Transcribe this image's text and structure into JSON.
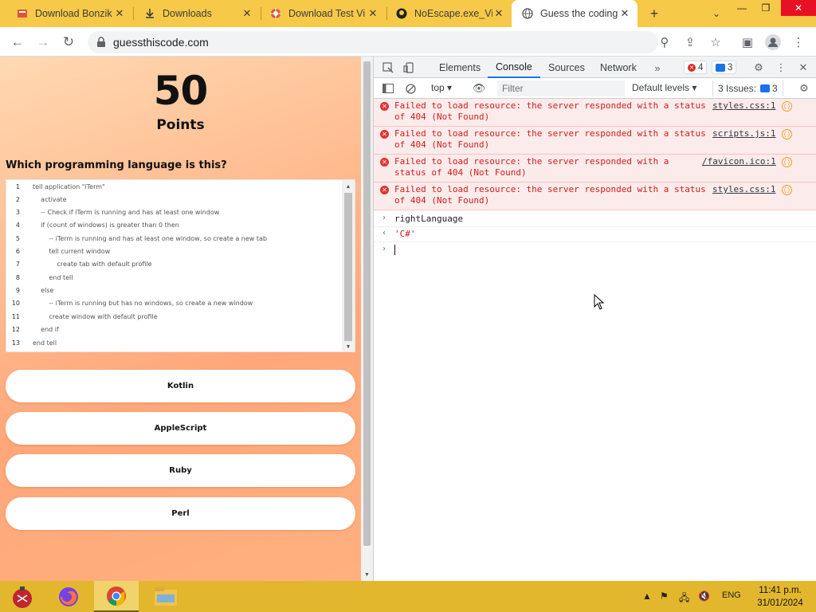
{
  "browser": {
    "tabs": [
      {
        "title": "Download Bonzik",
        "icon": "download-site-icon"
      },
      {
        "title": "Downloads",
        "icon": "download-icon"
      },
      {
        "title": "Download Test Vi",
        "icon": "target-site-icon"
      },
      {
        "title": "NoEscape.exe_Vi",
        "icon": "github-icon"
      },
      {
        "title": "Guess the coding",
        "icon": "globe-icon",
        "active": true
      }
    ],
    "url": "guessthiscode.com"
  },
  "page": {
    "score": "50",
    "score_label": "Points",
    "question": "Which programming language is this?",
    "code_lines": [
      {
        "n": "1",
        "text": "tell application \"iTerm\""
      },
      {
        "n": "2",
        "text": "    activate"
      },
      {
        "n": "3",
        "text": "    -- Check if iTerm is running and has at least one window"
      },
      {
        "n": "4",
        "text": "    if (count of windows) is greater than 0 then"
      },
      {
        "n": "5",
        "text": "        -- iTerm is running and has at least one window, so create a new tab"
      },
      {
        "n": "6",
        "text": "        tell current window"
      },
      {
        "n": "7",
        "text": "            create tab with default profile"
      },
      {
        "n": "8",
        "text": "        end tell"
      },
      {
        "n": "9",
        "text": "    else"
      },
      {
        "n": "10",
        "text": "        -- iTerm is running but has no windows, so create a new window"
      },
      {
        "n": "11",
        "text": "        create window with default profile"
      },
      {
        "n": "12",
        "text": "    end if"
      },
      {
        "n": "13",
        "text": "end tell"
      }
    ],
    "answers": [
      "Kotlin",
      "AppleScript",
      "Ruby",
      "Perl"
    ]
  },
  "devtools": {
    "tabs": [
      "Elements",
      "Console",
      "Sources",
      "Network"
    ],
    "active_tab": "Console",
    "error_count": "4",
    "message_count": "3",
    "context": "top",
    "filter_placeholder": "Filter",
    "levels": "Default levels",
    "issues_label": "3 Issues:",
    "issues_count": "3",
    "errors": [
      {
        "line1": "Failed to load resource: the server responded with a status",
        "line2": "of 404 (Not Found)",
        "source": "styles.css:1"
      },
      {
        "line1": "Failed to load resource: the server responded with a status",
        "line2": "of 404 (Not Found)",
        "source": "scripts.js:1"
      },
      {
        "line1": "Failed to load resource: the server responded with a",
        "line2": "status of 404 (Not Found)",
        "source": "/favicon.ico:1"
      },
      {
        "line1": "Failed to load resource: the server responded with a status",
        "line2": "of 404 (Not Found)",
        "source": "styles.css:1"
      }
    ],
    "input": "rightLanguage",
    "result": "'C#'"
  },
  "taskbar": {
    "language": "ENG",
    "time": "11:41 p.m.",
    "date": "31/01/2024"
  },
  "colors": {
    "tabstrip": "#f7c948",
    "taskbar": "#e2b72e",
    "error_text": "#d01c1c",
    "accent": "#1a73e8"
  }
}
